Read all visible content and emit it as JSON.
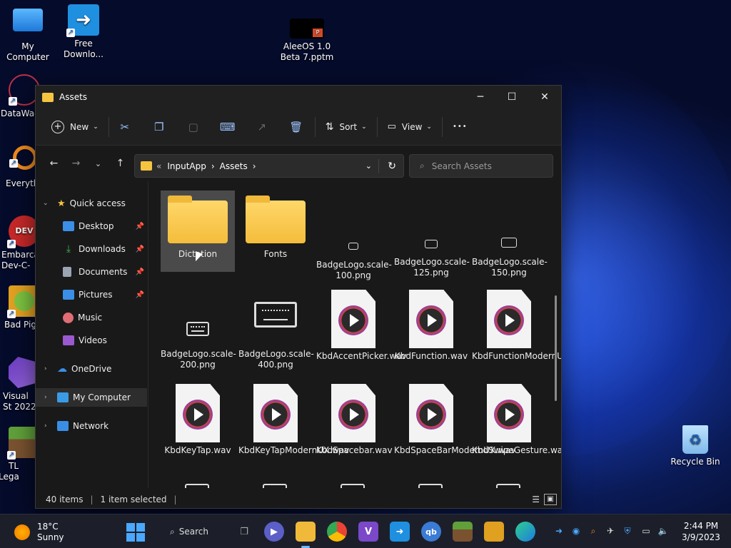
{
  "desktop": {
    "icons": [
      {
        "label": "My Computer"
      },
      {
        "label": "Free Downlo..."
      },
      {
        "label": "AleeOS 1.0 Beta 7.pptm"
      },
      {
        "label": "DataWag"
      },
      {
        "label": "Everyth"
      },
      {
        "label": "Embarca Dev-C-"
      },
      {
        "label": "Bad Pig"
      },
      {
        "label": "Visual St 2022"
      },
      {
        "label": "TL Lega"
      },
      {
        "label": "Recycle Bin"
      }
    ]
  },
  "window": {
    "title": "Assets",
    "controls": {
      "minimize": "─",
      "maximize": "☐",
      "close": "✕"
    },
    "toolbar": {
      "new_label": "New",
      "sort_label": "Sort",
      "view_label": "View",
      "more": "•••"
    },
    "address": {
      "prefix": "«",
      "crumbs": [
        "InputApp",
        "Assets"
      ],
      "sep": "›"
    },
    "search_placeholder": "Search Assets",
    "sidebar": {
      "quick_access": "Quick access",
      "items": [
        {
          "label": "Desktop",
          "color": "#3b8ee6",
          "pinned": true
        },
        {
          "label": "Downloads",
          "color": "#3fb950",
          "pinned": true
        },
        {
          "label": "Documents",
          "color": "#9aa4b2",
          "pinned": true
        },
        {
          "label": "Pictures",
          "color": "#3b8ee6",
          "pinned": true
        },
        {
          "label": "Music",
          "color": "#e06c75",
          "pinned": false
        },
        {
          "label": "Videos",
          "color": "#9b59d0",
          "pinned": false
        }
      ],
      "onedrive": "OneDrive",
      "my_computer": "My Computer",
      "network": "Network"
    },
    "files": [
      {
        "name": "Dictation",
        "type": "folder"
      },
      {
        "name": "Fonts",
        "type": "folder"
      },
      {
        "name": "BadgeLogo.scale-100.png",
        "type": "kbd",
        "size": 14
      },
      {
        "name": "BadgeLogo.scale-125.png",
        "type": "kbd",
        "size": 18
      },
      {
        "name": "BadgeLogo.scale-150.png",
        "type": "kbd",
        "size": 22
      },
      {
        "name": "BadgeLogo.scale-200.png",
        "type": "kbd",
        "size": 32
      },
      {
        "name": "BadgeLogo.scale-400.png",
        "type": "kbd",
        "size": 60
      },
      {
        "name": "KbdAccentPicker.wav",
        "type": "wav"
      },
      {
        "name": "KbdFunction.wav",
        "type": "wav"
      },
      {
        "name": "KbdFunctionModernUX.wav",
        "type": "wav"
      },
      {
        "name": "KbdKeyTap.wav",
        "type": "wav"
      },
      {
        "name": "KbdKeyTapModernUX.wav",
        "type": "wav"
      },
      {
        "name": "KbdSpacebar.wav",
        "type": "wav"
      },
      {
        "name": "KbdSpaceBarModernUX.wav",
        "type": "wav"
      },
      {
        "name": "KbdSwipeGesture.wav",
        "type": "wav"
      }
    ],
    "status": {
      "count": "40 items",
      "selected": "1 item selected"
    }
  },
  "taskbar": {
    "weather": {
      "temp": "18°C",
      "condition": "Sunny"
    },
    "search_label": "Search",
    "clock": {
      "time": "2:44 PM",
      "date": "3/9/2023"
    }
  }
}
